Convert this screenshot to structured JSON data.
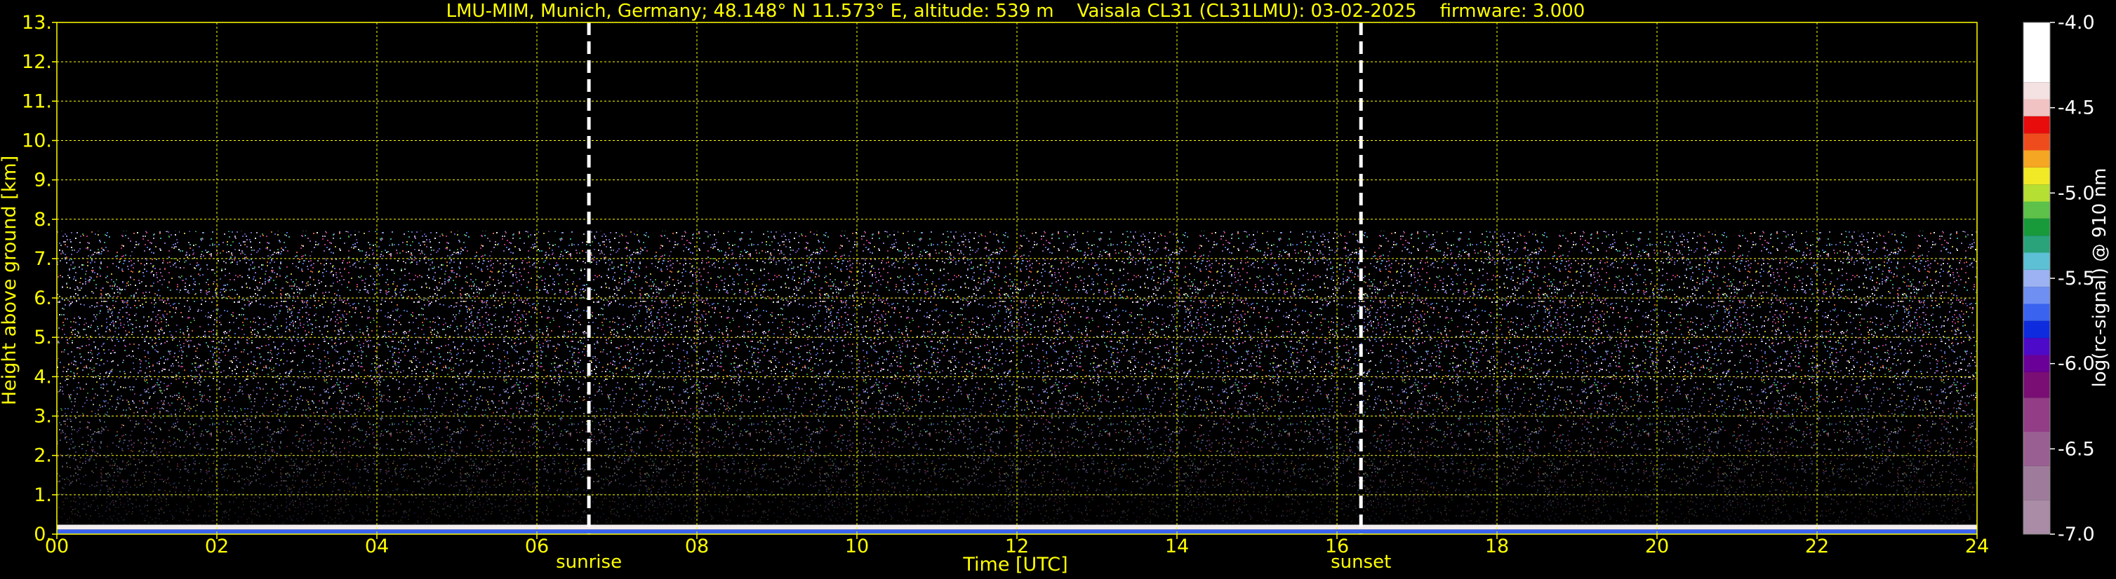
{
  "chart_data": {
    "type": "heatmap",
    "title": "LMU-MIM, Munich, Germany; 48.148° N 11.573° E, altitude: 539 m    Vaisala CL31 (CL31LMU): 03-02-2025    firmware: 3.000",
    "xlabel": "Time [UTC]",
    "ylabel": "Height above ground [km]",
    "xlim": [
      0,
      24
    ],
    "ylim": [
      0,
      13
    ],
    "x_ticks": [
      0,
      2,
      4,
      6,
      8,
      10,
      12,
      14,
      16,
      18,
      20,
      22,
      24
    ],
    "x_tick_labels": [
      "00",
      "02",
      "04",
      "06",
      "08",
      "10",
      "12",
      "14",
      "16",
      "18",
      "20",
      "22",
      "24"
    ],
    "y_ticks": [
      0,
      1,
      2,
      3,
      4,
      5,
      6,
      7,
      8,
      9,
      10,
      11,
      12,
      13
    ],
    "y_tick_labels": [
      "0.",
      "1.",
      "2.",
      "3.",
      "4.",
      "5.",
      "6.",
      "7.",
      "8.",
      "9.",
      "10.",
      "11.",
      "12.",
      "13."
    ],
    "grid": true,
    "measurement_top_km": 7.7,
    "events": [
      {
        "label": "sunrise",
        "time": 6.65
      },
      {
        "label": "sunset",
        "time": 16.3
      }
    ],
    "colorbar": {
      "label": "log(rc-signal) @ 910 nm",
      "range": [
        -7.0,
        -4.0
      ],
      "ticks": [
        -4.0,
        -4.5,
        -5.0,
        -5.5,
        -6.0,
        -6.5,
        -7.0
      ],
      "tick_labels": [
        "-4.0",
        "-4.5",
        "-5.0",
        "-5.5",
        "-6.0",
        "-6.5",
        "-7.0"
      ],
      "colors": [
        {
          "from": -7.0,
          "to": -6.8,
          "color": "#aa8ca6"
        },
        {
          "from": -6.8,
          "to": -6.6,
          "color": "#9e7b9b"
        },
        {
          "from": -6.6,
          "to": -6.4,
          "color": "#9a5f92"
        },
        {
          "from": -6.4,
          "to": -6.2,
          "color": "#923d86"
        },
        {
          "from": -6.2,
          "to": -6.05,
          "color": "#7a0e74"
        },
        {
          "from": -6.05,
          "to": -5.95,
          "color": "#6a0098"
        },
        {
          "from": -5.95,
          "to": -5.85,
          "color": "#4d0ac8"
        },
        {
          "from": -5.85,
          "to": -5.75,
          "color": "#0f2bde"
        },
        {
          "from": -5.75,
          "to": -5.65,
          "color": "#3a63ef"
        },
        {
          "from": -5.65,
          "to": -5.55,
          "color": "#6f8ff3"
        },
        {
          "from": -5.55,
          "to": -5.45,
          "color": "#9cb2f2"
        },
        {
          "from": -5.45,
          "to": -5.35,
          "color": "#5dc0d5"
        },
        {
          "from": -5.35,
          "to": -5.25,
          "color": "#2aa37b"
        },
        {
          "from": -5.25,
          "to": -5.15,
          "color": "#189a3a"
        },
        {
          "from": -5.15,
          "to": -5.05,
          "color": "#5dc14a"
        },
        {
          "from": -5.05,
          "to": -4.95,
          "color": "#b6df34"
        },
        {
          "from": -4.95,
          "to": -4.85,
          "color": "#f2e926"
        },
        {
          "from": -4.85,
          "to": -4.75,
          "color": "#f5a623"
        },
        {
          "from": -4.75,
          "to": -4.65,
          "color": "#ef4c1e"
        },
        {
          "from": -4.65,
          "to": -4.55,
          "color": "#e80c0c"
        },
        {
          "from": -4.55,
          "to": -4.45,
          "color": "#f1c3c3"
        },
        {
          "from": -4.45,
          "to": -4.35,
          "color": "#f4e1e1"
        },
        {
          "from": -4.35,
          "to": -4.0,
          "color": "#ffffff"
        }
      ]
    }
  },
  "colors": {
    "background": "#000000",
    "text": "#ffff00",
    "grid": "#ffff00",
    "event_line": "#ffffff"
  }
}
